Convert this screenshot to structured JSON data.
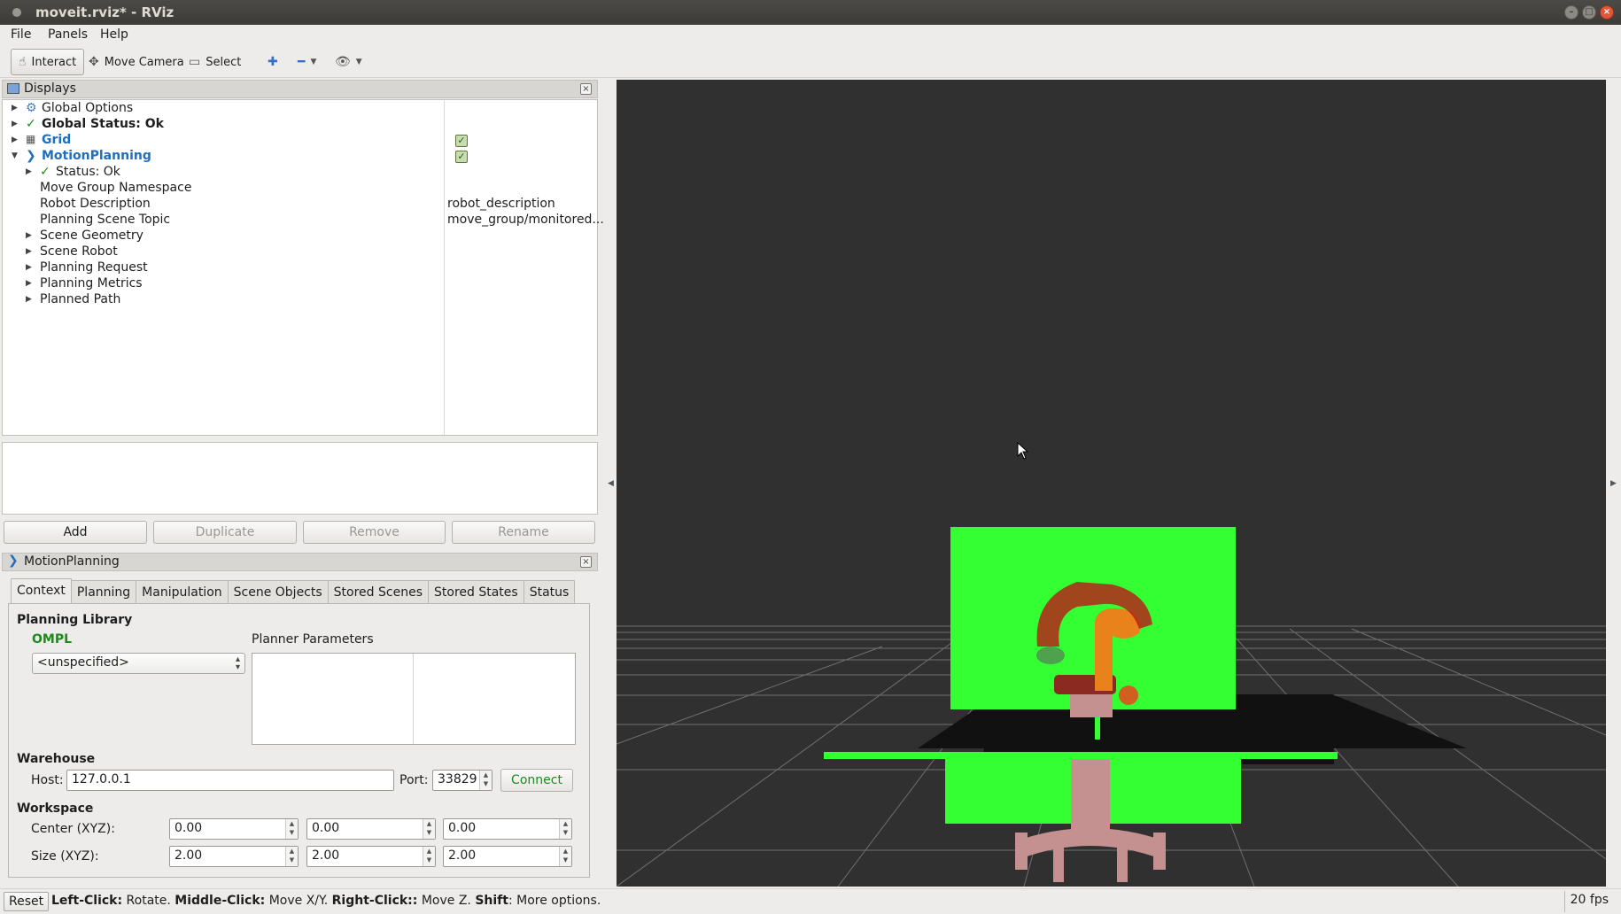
{
  "window": {
    "title": "moveit.rviz* - RViz"
  },
  "menu": {
    "file": "File",
    "panels": "Panels",
    "help": "Help"
  },
  "toolbar": {
    "interact": "Interact",
    "move_camera": "Move Camera",
    "select": "Select"
  },
  "displays": {
    "title": "Displays",
    "items": [
      {
        "label": "Global Options"
      },
      {
        "label": "Global Status: Ok"
      },
      {
        "label": "Grid"
      },
      {
        "label": "MotionPlanning"
      },
      {
        "label": "Status: Ok"
      },
      {
        "label": "Move Group Namespace"
      },
      {
        "label": "Robot Description",
        "value": "robot_description"
      },
      {
        "label": "Planning Scene Topic",
        "value": "move_group/monitored..."
      },
      {
        "label": "Scene Geometry"
      },
      {
        "label": "Scene Robot"
      },
      {
        "label": "Planning Request"
      },
      {
        "label": "Planning Metrics"
      },
      {
        "label": "Planned Path"
      }
    ],
    "buttons": {
      "add": "Add",
      "duplicate": "Duplicate",
      "remove": "Remove",
      "rename": "Rename"
    }
  },
  "motion_planning": {
    "title": "MotionPlanning",
    "tabs": [
      "Context",
      "Planning",
      "Manipulation",
      "Scene Objects",
      "Stored Scenes",
      "Stored States",
      "Status"
    ],
    "planning_library": "Planning Library",
    "library_name": "OMPL",
    "planner_select": "<unspecified>",
    "planner_parameters": "Planner Parameters",
    "warehouse": "Warehouse",
    "host_label": "Host:",
    "host_value": "127.0.0.1",
    "port_label": "Port:",
    "port_value": "33829",
    "connect": "Connect",
    "workspace": "Workspace",
    "center_label": "Center (XYZ):",
    "center": [
      "0.00",
      "0.00",
      "0.00"
    ],
    "size_label": "Size (XYZ):",
    "size": [
      "2.00",
      "2.00",
      "2.00"
    ]
  },
  "statusbar": {
    "reset": "Reset",
    "hint_parts": [
      {
        "b": "Left-Click:",
        "t": " Rotate. "
      },
      {
        "b": "Middle-Click:",
        "t": " Move X/Y. "
      },
      {
        "b": "Right-Click::",
        "t": " Move Z. "
      },
      {
        "b": "Shift",
        "t": ": More options."
      }
    ],
    "fps": "20 fps"
  },
  "colors": {
    "viewport_bg": "#303030",
    "scene_green": "#33ff33",
    "robot_orange": "#e9821a",
    "robot_red": "#b5251a",
    "robot_pink": "#c49090",
    "link_blue": "#1f6fbf"
  }
}
